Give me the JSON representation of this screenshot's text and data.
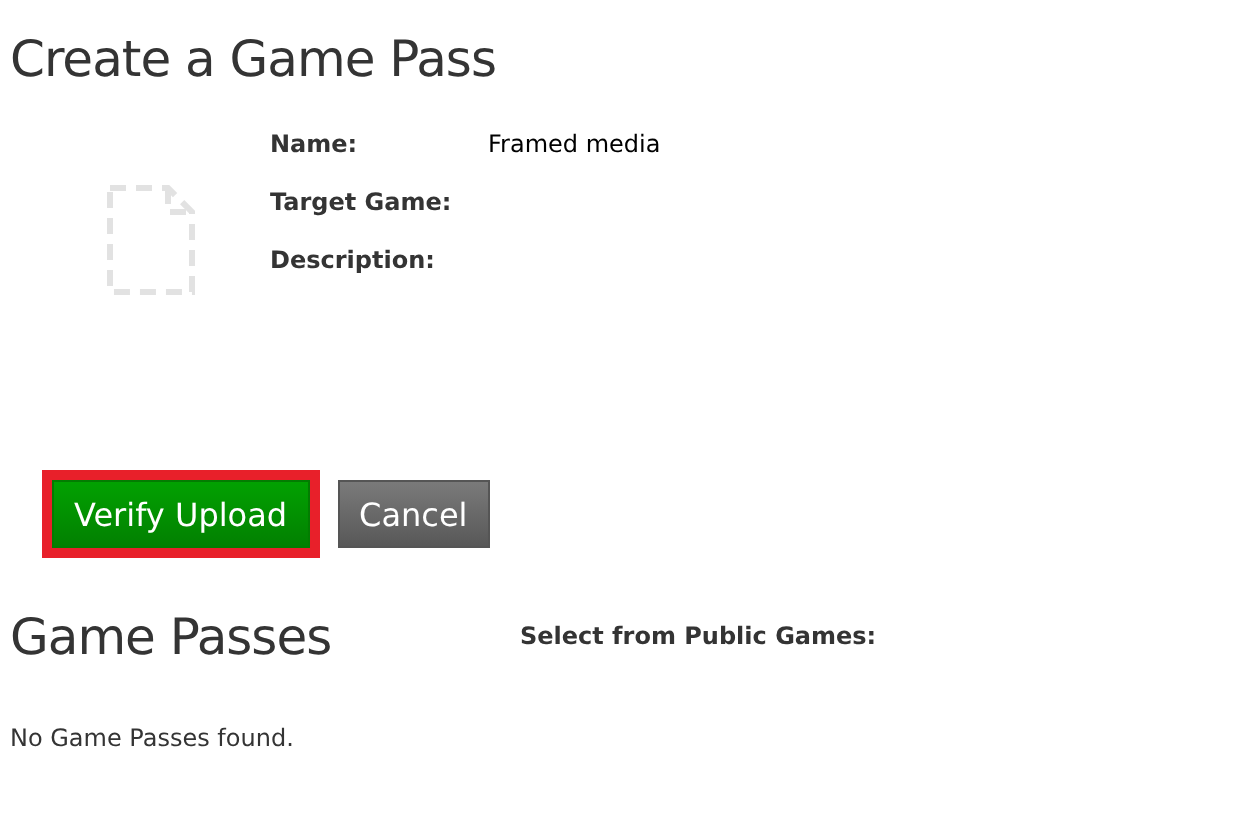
{
  "title": "Create a Game Pass",
  "fields": [
    {
      "label": "Name:",
      "value": "Framed media"
    },
    {
      "label": "Target Game:"
    },
    {
      "label": "Description:"
    }
  ],
  "buttons": [
    {
      "label": "Verify Upload",
      "kind": "primary",
      "highlighted": true
    },
    {
      "label": "Cancel",
      "kind": "secondary",
      "highlighted": false
    }
  ],
  "section": {
    "title": "Game Passes",
    "filter_label": "Select from Public Games:",
    "empty_message": "No Game Passes found."
  }
}
